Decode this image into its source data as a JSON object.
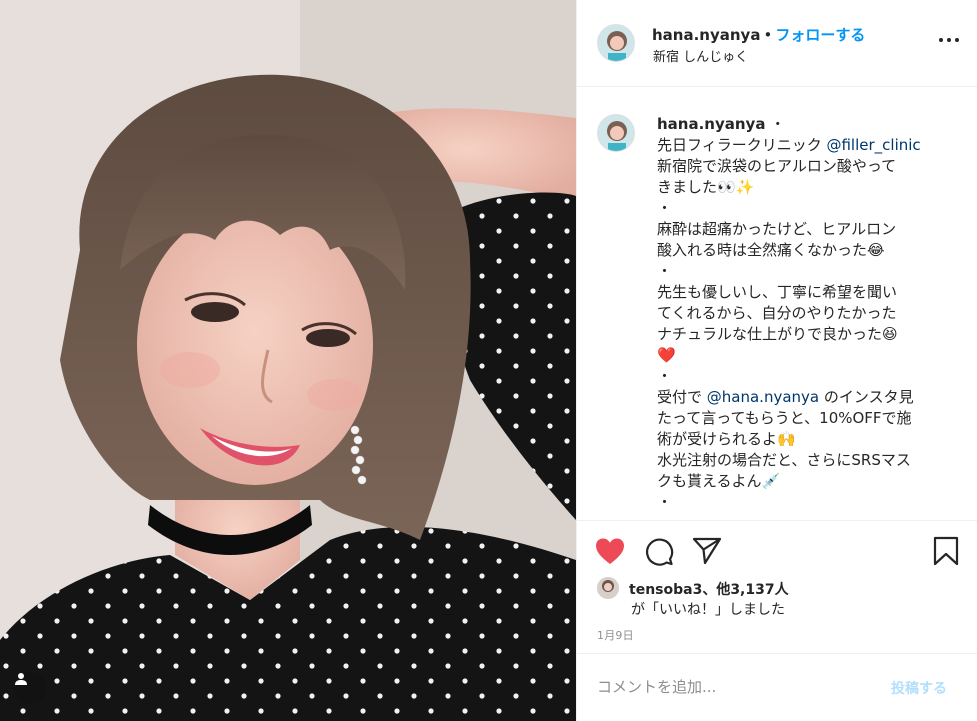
{
  "photo": {
    "alt_subject": "selfie",
    "user_tag_icon": "person-icon"
  },
  "header": {
    "username": "hana.nyanya",
    "separator": "•",
    "follow_label": "フォローする",
    "location": "新宿 しんじゅく",
    "more_icon": "more-horizontal-icon"
  },
  "caption": {
    "username": "hana.nyanya",
    "separator": "・",
    "lines": [
      {
        "text": "先日フィラークリニック ",
        "mention": "@filler_clinic"
      },
      {
        "text": "新宿院で涙袋のヒアルロン酸やって"
      },
      {
        "text": "きました👀✨"
      },
      {
        "text": "・"
      },
      {
        "text": "麻酔は超痛かったけど、ヒアルロン"
      },
      {
        "text": "酸入れる時は全然痛くなかった😂"
      },
      {
        "text": "・"
      },
      {
        "text": "先生も優しいし、丁寧に希望を聞い"
      },
      {
        "text": "てくれるから、自分のやりたかった"
      },
      {
        "text": "ナチュラルな仕上がりで良かった😆"
      },
      {
        "text": "❤️"
      },
      {
        "text": "・"
      },
      {
        "text_before": "受付で ",
        "mention": "@hana.nyanya",
        "text_after": " のインスタ見"
      },
      {
        "text": "たって言ってもらうと、10%OFFで施"
      },
      {
        "text": "術が受けられるよ🙌"
      },
      {
        "text": "水光注射の場合だと、さらにSRSマス"
      },
      {
        "text": "クも貰えるよん💉"
      },
      {
        "text": "・"
      }
    ]
  },
  "actions": {
    "like_icon": "heart-filled-icon",
    "comment_icon": "comment-icon",
    "share_icon": "paper-plane-icon",
    "save_icon": "bookmark-icon",
    "like_color": "#ed4956"
  },
  "likes": {
    "text": "tensoba3、他3,137人",
    "liked_suffix": "が「いいね！」しました"
  },
  "date": "1月9日",
  "comment": {
    "placeholder": "コメントを追加...",
    "post_label": "投稿する"
  },
  "colors": {
    "accent": "#0095f6",
    "mention": "#00376b",
    "muted": "#8e8e8e",
    "post_disabled": "#b2dffc"
  }
}
